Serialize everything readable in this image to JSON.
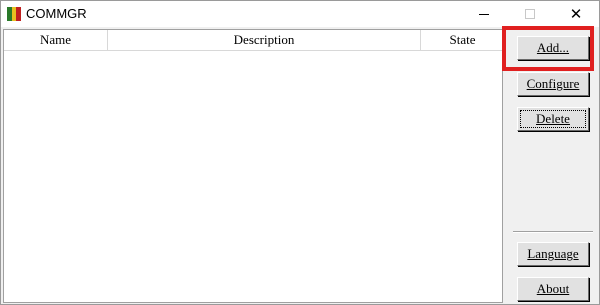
{
  "window": {
    "title": "COMMGR",
    "icon": "app-flag-icon",
    "icon_colors": [
      "#2a7a2a",
      "#e8c020",
      "#c02020"
    ],
    "controls": {
      "minimize": "minimize-icon",
      "maximize": "maximize-icon",
      "close_label": "✕"
    }
  },
  "list": {
    "columns": [
      "Name",
      "Description",
      "State"
    ],
    "rows": []
  },
  "buttons": {
    "add": "Add...",
    "configure": "Configure",
    "delete": "Delete",
    "language": "Language",
    "about": "About"
  },
  "highlight": {
    "color": "#e02020",
    "target": "Add..."
  }
}
